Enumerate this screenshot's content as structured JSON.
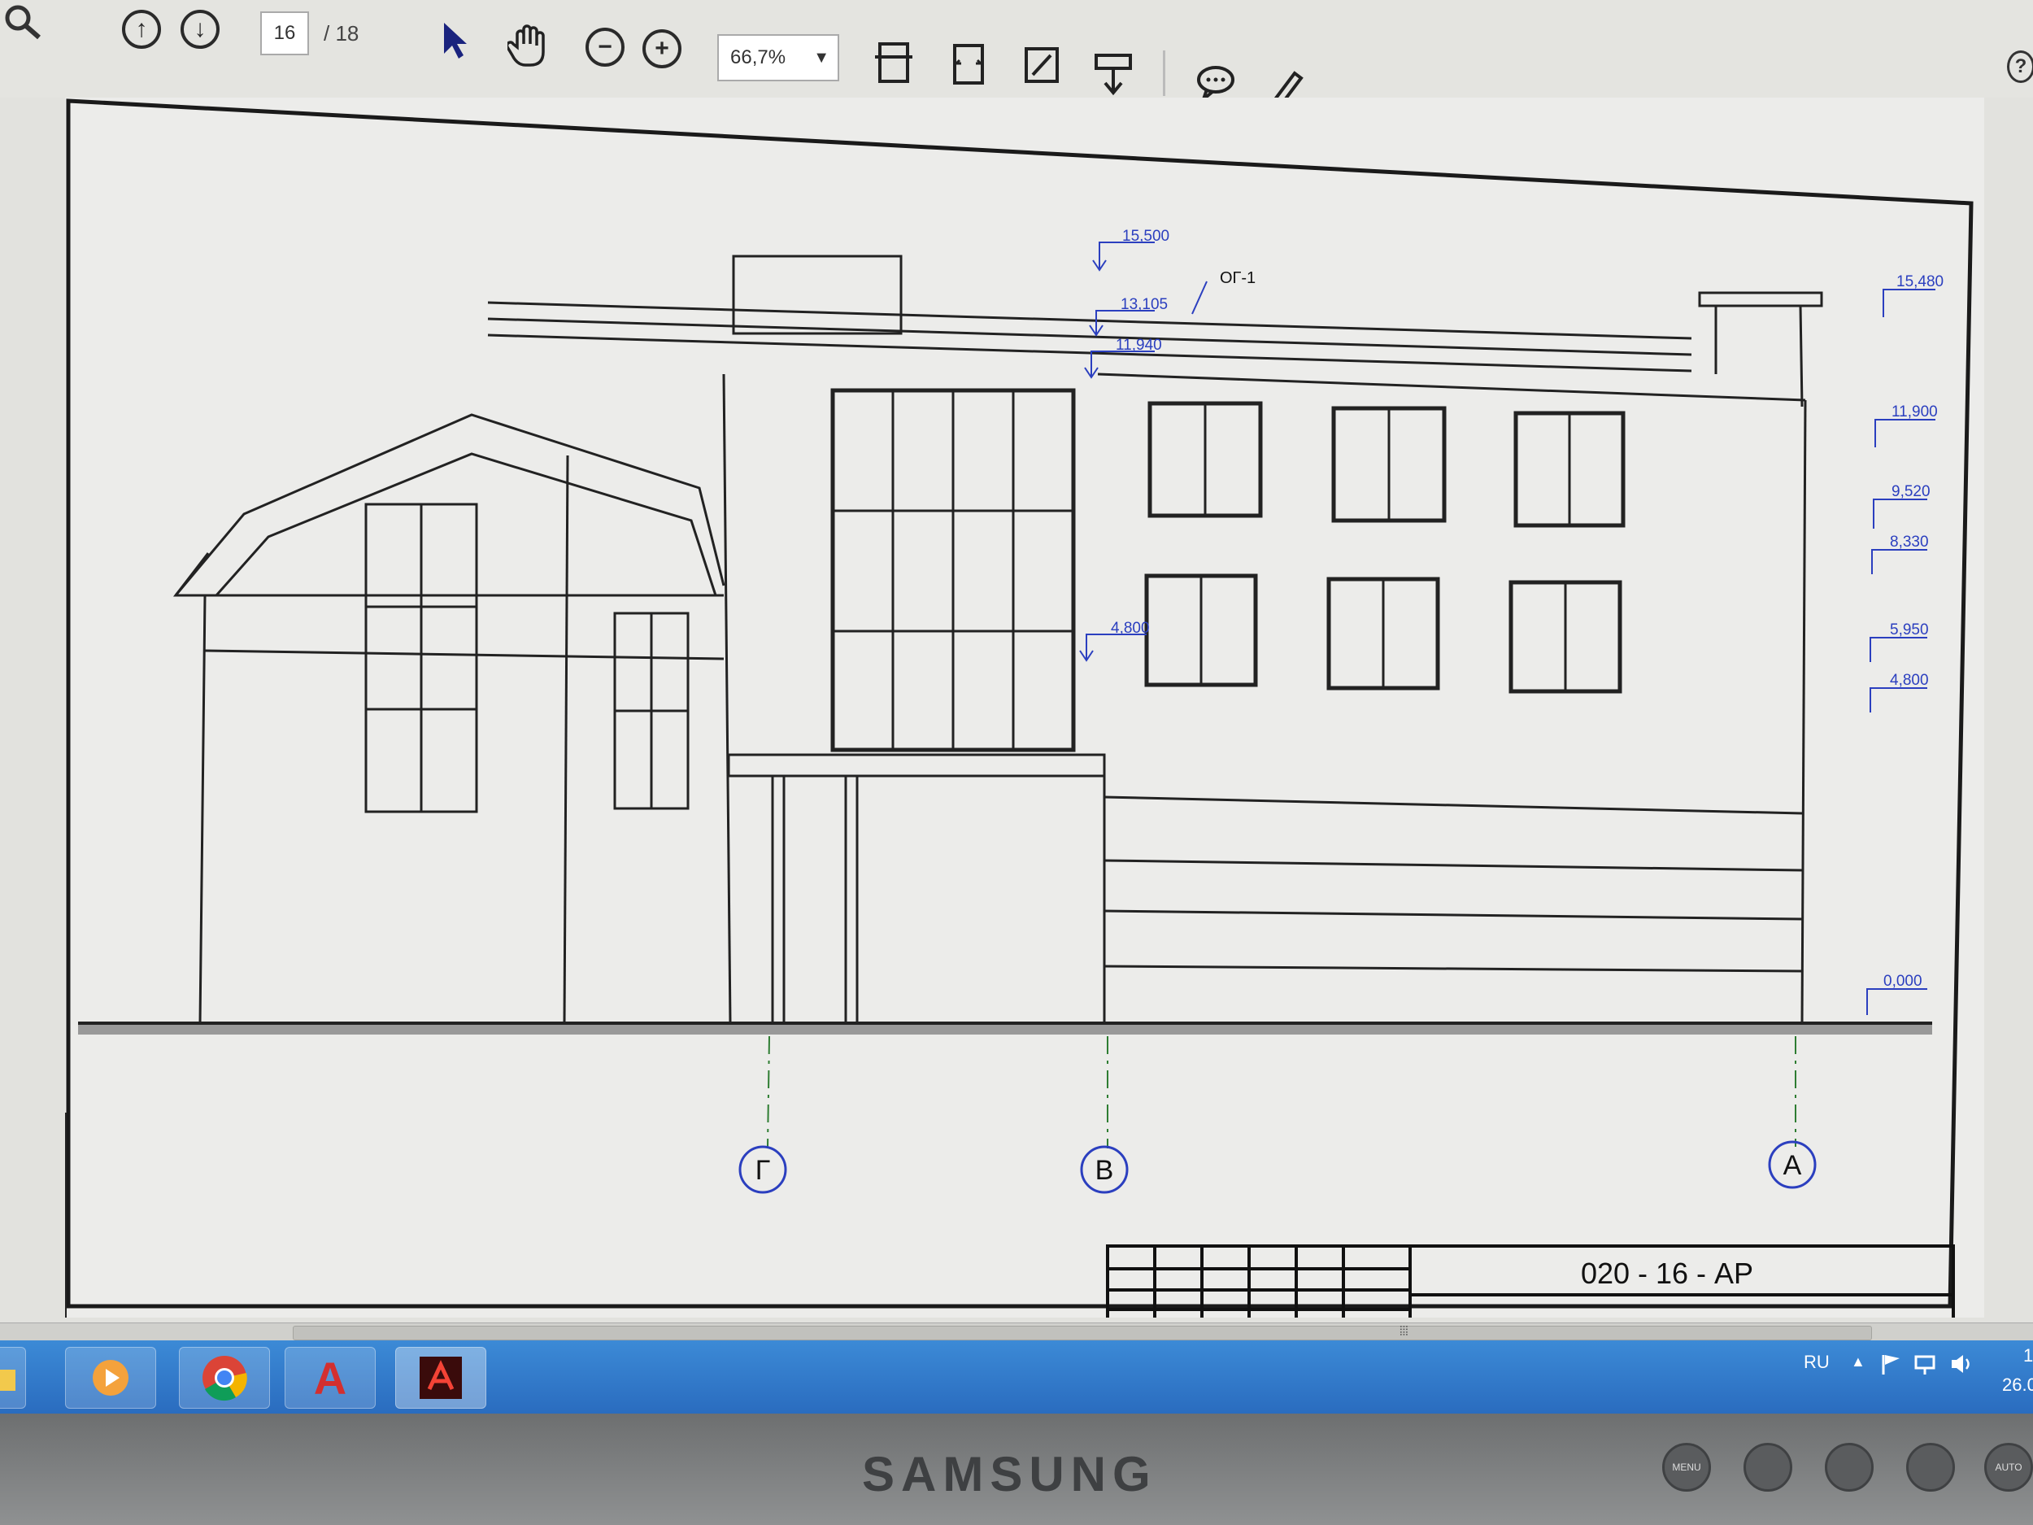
{
  "toolbar": {
    "page_current": "16",
    "page_total": "/ 18",
    "zoom": "66,7%"
  },
  "drawing": {
    "callout": "ОГ-1",
    "levels_center": [
      "15,500",
      "13,105",
      "11,940",
      "4,800"
    ],
    "levels_right": [
      "15,480",
      "11,900",
      "9,520",
      "8,330",
      "5,950",
      "4,800",
      "0,000"
    ],
    "axes": [
      "Г",
      "В",
      "А"
    ],
    "title_block_code": "020 - 16 - АР"
  },
  "taskbar": {
    "language": "RU",
    "clock_top": "1",
    "clock_bottom": "26.0"
  },
  "monitor": {
    "brand": "SAMSUNG",
    "buttons": [
      "MENU",
      "",
      "",
      "",
      "AUTO"
    ]
  }
}
